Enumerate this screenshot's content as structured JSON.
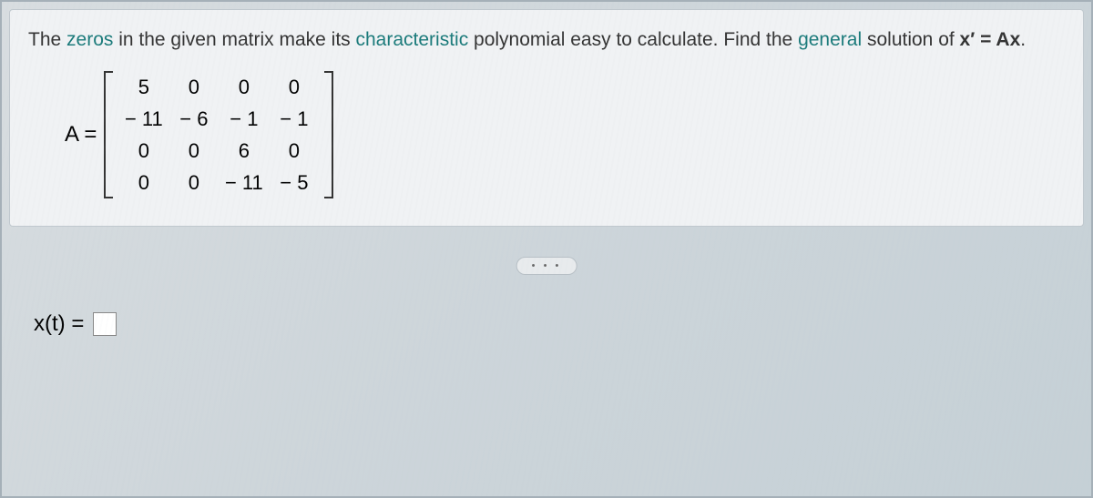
{
  "question": {
    "prefix": "The ",
    "zeros": "zeros",
    "mid1": " in the given matrix make its ",
    "characteristic": "characteristic",
    "mid2": " polynomial easy to calculate. Find the ",
    "general": "general",
    "mid3": " solution of ",
    "equation": "x′ = Ax",
    "suffix": "."
  },
  "matrix": {
    "label": "A =",
    "rows": [
      [
        "5",
        "0",
        "0",
        "0"
      ],
      [
        "− 11",
        "− 6",
        "− 1",
        "− 1"
      ],
      [
        "0",
        "0",
        "6",
        "0"
      ],
      [
        "0",
        "0",
        "− 11",
        "− 5"
      ]
    ]
  },
  "divider": "• • •",
  "answer": {
    "label": "x(t) ="
  }
}
